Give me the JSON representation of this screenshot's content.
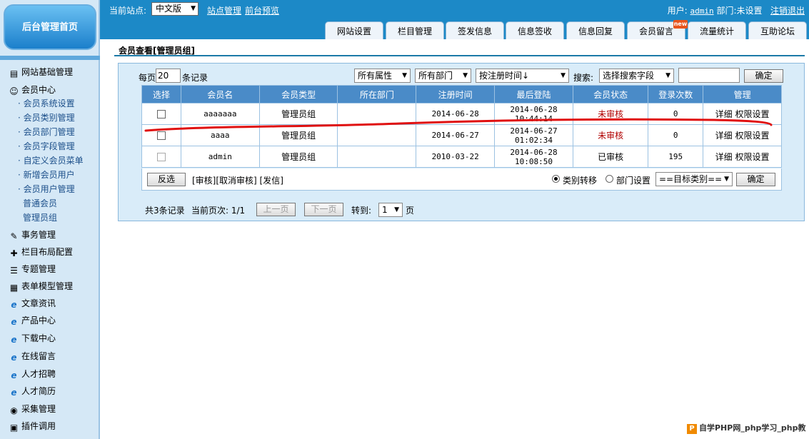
{
  "sidebar": {
    "home": "后台管理首页",
    "items": [
      {
        "label": "网站基础管理",
        "icon": "site-icon",
        "glyph": "▤"
      },
      {
        "label": "会员中心",
        "icon": "members-icon",
        "glyph": "☺"
      },
      {
        "label": "事务管理",
        "icon": "affairs-icon",
        "glyph": "✎"
      },
      {
        "label": "栏目布局配置",
        "icon": "tools-icon",
        "glyph": "✚"
      },
      {
        "label": "专题管理",
        "icon": "topic-icon",
        "glyph": "☰"
      },
      {
        "label": "表单模型管理",
        "icon": "form-icon",
        "glyph": "▦"
      },
      {
        "label": "文章资讯",
        "icon": "ie-icon",
        "glyph": "e"
      },
      {
        "label": "产品中心",
        "icon": "ie-icon",
        "glyph": "e"
      },
      {
        "label": "下载中心",
        "icon": "ie-icon",
        "glyph": "e"
      },
      {
        "label": "在线留言",
        "icon": "ie-icon",
        "glyph": "e"
      },
      {
        "label": "人才招聘",
        "icon": "ie-icon",
        "glyph": "e"
      },
      {
        "label": "人才简历",
        "icon": "ie-icon",
        "glyph": "e"
      },
      {
        "label": "采集管理",
        "icon": "collect-icon",
        "glyph": "◉"
      },
      {
        "label": "插件调用",
        "icon": "plugin-icon",
        "glyph": "▣"
      }
    ],
    "sub": [
      "会员系统设置",
      "会员类别管理",
      "会员部门管理",
      "会员字段管理",
      "自定义会员菜单",
      "新增会员用户",
      "会员用户管理"
    ],
    "sub2": [
      "普通会员",
      "管理员组"
    ]
  },
  "topbar": {
    "site_label": "当前站点:",
    "site_value": "中文版",
    "site_manage": "站点管理",
    "front_preview": "前台预览",
    "user_label": "用户:",
    "user_name": "admin",
    "dept_label": "部门:",
    "dept_value": "未设置",
    "logout": "注销退出",
    "new_badge": "new"
  },
  "tabs": [
    "网站设置",
    "栏目管理",
    "签发信息",
    "信息签收",
    "信息回复",
    "会员留言",
    "流量统计",
    "互助论坛"
  ],
  "page": {
    "title": "会员查看[管理员组]",
    "per_page_label": "每页",
    "per_page_value": "20",
    "per_page_unit": "条记录",
    "filter_attr": "所有属性",
    "filter_dept": "所有部门",
    "sort": "按注册时间↓",
    "search_label": "搜索:",
    "search_field": "选择搜索字段",
    "search_value": "",
    "confirm": "确定"
  },
  "table": {
    "headers": [
      "选择",
      "会员名",
      "会员类型",
      "所在部门",
      "注册时间",
      "最后登陆",
      "会员状态",
      "登录次数",
      "管理"
    ],
    "rows": [
      {
        "name": "aaaaaaa",
        "type": "管理员组",
        "dept": "",
        "reg": "2014-06-28",
        "last": "2014-06-28 10:44:14",
        "status": "未审核",
        "logins": "0",
        "detail": "详细",
        "perm": "权限设置"
      },
      {
        "name": "aaaa",
        "type": "管理员组",
        "dept": "",
        "reg": "2014-06-27",
        "last": "2014-06-27 01:02:34",
        "status": "未审核",
        "logins": "0",
        "detail": "详细",
        "perm": "权限设置"
      },
      {
        "name": "admin",
        "type": "管理员组",
        "dept": "",
        "reg": "2010-03-22",
        "last": "2014-06-28 10:08:50",
        "status": "已审核",
        "logins": "195",
        "detail": "详细",
        "perm": "权限设置"
      }
    ]
  },
  "actions": {
    "invert": "反选",
    "links": "[审核][取消审核] [发信]",
    "radio_move": "类别转移",
    "radio_dept": "部门设置",
    "target": "==目标类别==",
    "confirm": "确定"
  },
  "pager": {
    "total": "共3条记录",
    "current": "当前页次: 1/1",
    "prev": "上一页",
    "next": "下一页",
    "goto_label": "转到:",
    "goto_value": "1",
    "unit": "页"
  },
  "watermark": "自学PHP网_php学习_php教"
}
